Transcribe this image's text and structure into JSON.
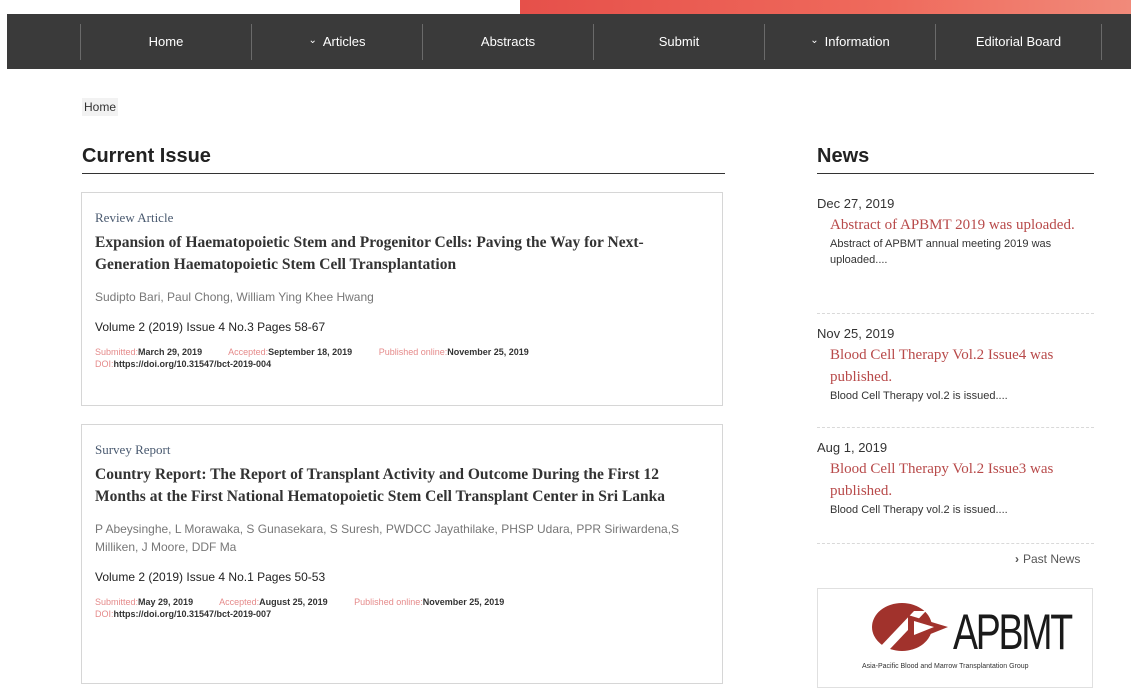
{
  "nav": {
    "items": [
      {
        "label": "Home",
        "dropdown": false
      },
      {
        "label": "Articles",
        "dropdown": true
      },
      {
        "label": "Abstracts",
        "dropdown": false
      },
      {
        "label": "Submit",
        "dropdown": false
      },
      {
        "label": "Information",
        "dropdown": true
      },
      {
        "label": "Editorial Board",
        "dropdown": false
      }
    ],
    "chevron": "⌄"
  },
  "breadcrumb": "Home",
  "current_issue": {
    "title": "Current Issue",
    "articles": [
      {
        "type": "Review Article",
        "title": "Expansion of Haematopoietic Stem and Progenitor Cells: Paving the Way for Next-Generation Haematopoietic Stem Cell Transplantation",
        "authors": "Sudipto Bari, Paul Chong, William Ying Khee Hwang",
        "volume": "Volume 2 (2019) Issue 4 No.3 Pages 58-67",
        "submitted_label": "Submitted:",
        "submitted": "March 29, 2019",
        "accepted_label": "Accepted:",
        "accepted": "September 18, 2019",
        "published_label": "Published online:",
        "published": "November 25, 2019",
        "doi_label": "DOI:",
        "doi": "https://doi.org/10.31547/bct-2019-004"
      },
      {
        "type": "Survey Report",
        "title": "Country Report: The Report of Transplant Activity and Outcome During the First 12 Months at the First National Hematopoietic Stem Cell Transplant Center in Sri Lanka",
        "authors": "P Abeysinghe, L Morawaka, S Gunasekara, S Suresh, PWDCC Jayathilake, PHSP Udara, PPR Siriwardena,S Milliken, J Moore, DDF Ma",
        "volume": "Volume 2 (2019) Issue 4 No.1 Pages 50-53",
        "submitted_label": "Submitted:",
        "submitted": "May 29, 2019",
        "accepted_label": "Accepted:",
        "accepted": "August 25, 2019",
        "published_label": "Published online:",
        "published": "November 25, 2019",
        "doi_label": "DOI:",
        "doi": "https://doi.org/10.31547/bct-2019-007"
      }
    ]
  },
  "news": {
    "title": "News",
    "items": [
      {
        "date": "Dec 27, 2019",
        "title": "Abstract of APBMT 2019 was uploaded.",
        "summary": "Abstract of APBMT annual meeting 2019 was uploaded...."
      },
      {
        "date": "Nov 25, 2019",
        "title": "Blood Cell Therapy Vol.2 Issue4 was published.",
        "summary": "Blood Cell Therapy vol.2 is issued...."
      },
      {
        "date": "Aug 1, 2019",
        "title": "Blood Cell Therapy Vol.2 Issue3 was published.",
        "summary": "Blood Cell Therapy vol.2 is issued...."
      }
    ],
    "past_news": "Past News",
    "past_news_icon": "›"
  },
  "apbmt_logo": {
    "text": "APBMT",
    "subtitle": "Asia-Pacific Blood and Marrow Transplantation Group"
  },
  "colors": {
    "nav_bg": "#3a3a3a",
    "accent_red": "#b84a4a",
    "date_label": "#e58a8a"
  }
}
